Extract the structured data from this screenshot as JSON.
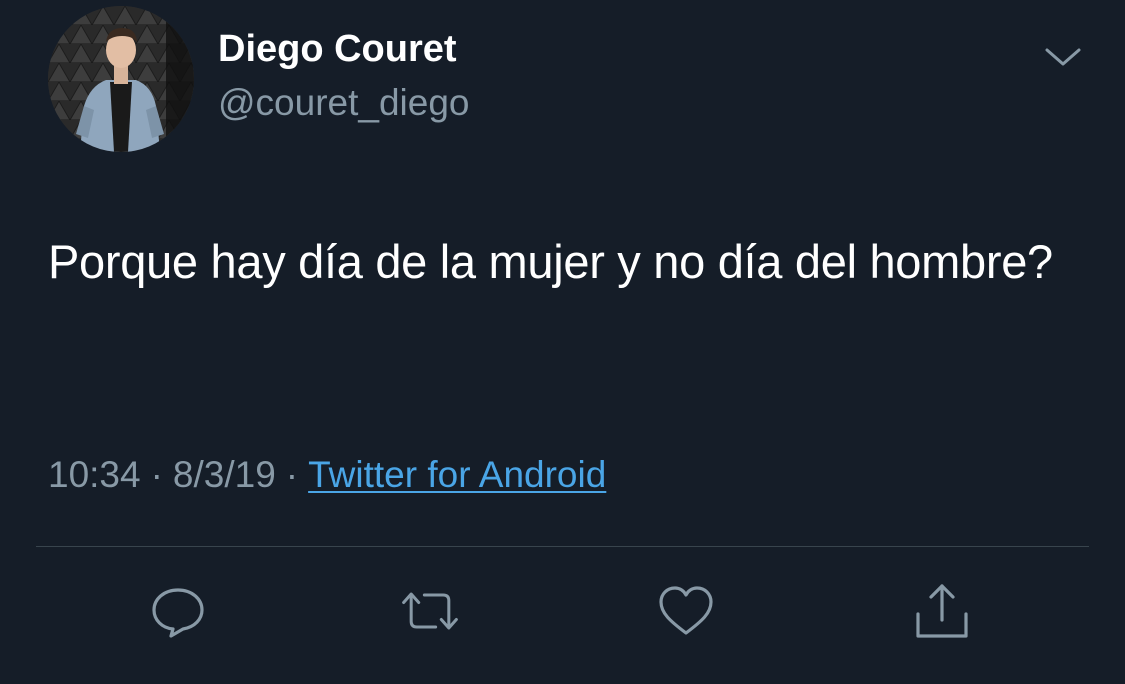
{
  "tweet": {
    "author": {
      "display_name": "Diego Couret",
      "handle": "@couret_diego"
    },
    "text": "Porque hay día de la mujer y no día del hombre?",
    "meta": {
      "time": "10:34",
      "date": "8/3/19",
      "separator": "·",
      "source": "Twitter for Android"
    },
    "actions": [
      {
        "name": "reply",
        "icon": "reply-icon"
      },
      {
        "name": "retweet",
        "icon": "retweet-icon"
      },
      {
        "name": "like",
        "icon": "heart-icon"
      },
      {
        "name": "share",
        "icon": "share-icon"
      }
    ],
    "colors": {
      "background": "#151d28",
      "secondary_text": "#8899a6",
      "link": "#4aa5e6",
      "divider": "#38444d"
    }
  }
}
